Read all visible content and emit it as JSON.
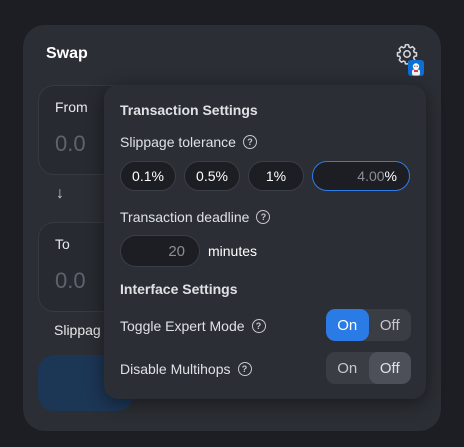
{
  "swap": {
    "title": "Swap",
    "from_label": "From",
    "from_amount": "0.0",
    "to_label": "To",
    "to_amount": "0.0",
    "slippage_label": "Slippag",
    "settings_icon": "gear-icon",
    "avatar_icon": "avatar-icon"
  },
  "settings": {
    "transaction_title": "Transaction Settings",
    "slippage_label": "Slippage tolerance",
    "slippage_options": [
      "0.1%",
      "0.5%",
      "1%"
    ],
    "slippage_custom_value": "4.00",
    "slippage_custom_unit": "%",
    "deadline_label": "Transaction deadline",
    "deadline_value": "20",
    "deadline_unit": "minutes",
    "interface_title": "Interface Settings",
    "expert_mode_label": "Toggle Expert Mode",
    "expert_mode_state": "On",
    "multihops_label": "Disable Multihops",
    "multihops_state": "Off",
    "toggle_on": "On",
    "toggle_off": "Off",
    "help_icon": "?"
  },
  "colors": {
    "accent": "#2a7be6",
    "card": "#2b2e34",
    "background": "#1c1e23"
  }
}
